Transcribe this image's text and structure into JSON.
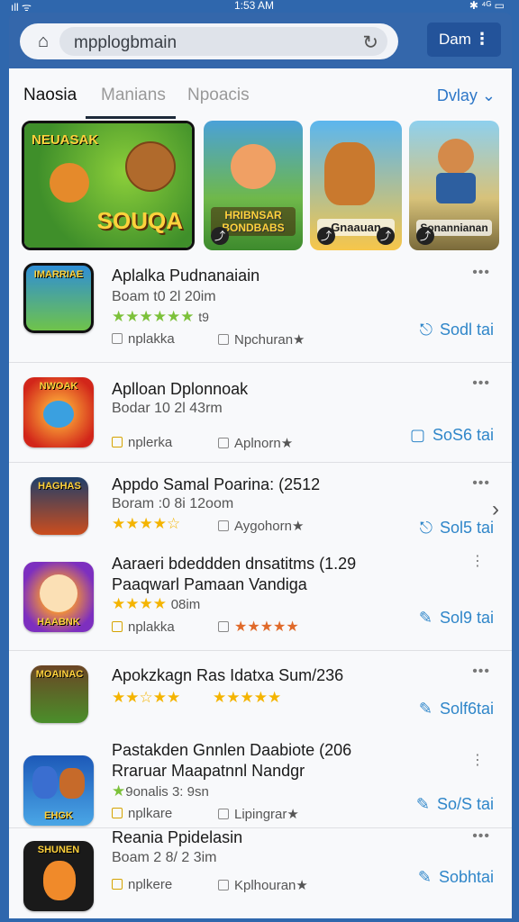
{
  "statusbar": {
    "time": "1:53 AM",
    "left": "ıll ᯤ",
    "right": "✱ ⁴ᴳ ▭"
  },
  "header": {
    "url": "mpplogbmain",
    "menu_label": "Dam"
  },
  "tabs": [
    {
      "label": "Naosia",
      "active": true
    },
    {
      "label": "Manians",
      "active": false
    },
    {
      "label": "Npoacis",
      "active": false
    }
  ],
  "sort_label": "Dvlay ⌄",
  "banners": [
    {
      "title": "SOUQA",
      "top_text": "NEUASAK",
      "colors": [
        "#3f8f2a",
        "#8ccf3a"
      ]
    },
    {
      "title": "HRIBNSAR BONDBABS",
      "colors": [
        "#4aa1d8",
        "#3d8a2d"
      ]
    },
    {
      "title": "Gnaauan",
      "colors": [
        "#5bb6ee",
        "#f7c64a"
      ]
    },
    {
      "title": "Sonannianan",
      "colors": [
        "#8ed0ee",
        "#7a6a3a"
      ]
    }
  ],
  "apps": [
    {
      "name": "Aplalka Pudnanaiain",
      "sub": "Boam t0 2l 20im",
      "stars": "★★★★★★",
      "stars_note": "t9",
      "meta1": "nplakka",
      "meta2": "Npchuran★",
      "action": "Sodl tai",
      "icon_label": "IMARRIAE",
      "icon_colors": [
        "#2f8ed6",
        "#6fc34a"
      ]
    },
    {
      "name": "Aplloan Dplonnoak",
      "sub": "Bodar 10 2l 43rm",
      "meta1": "nplerka",
      "meta2": "Aplnorn★",
      "action": "SoS6 tai",
      "icon_label": "NWOAK",
      "icon_colors": [
        "#ff8a1f",
        "#d2261a"
      ]
    },
    {
      "name": "Appdo Samal Poarina: (2512",
      "sub": "Boram :0 8i 12oom",
      "stars": "★★★★☆",
      "meta2": "Aygohorn★",
      "action": "Sol5 tai",
      "icon_label": "HAGHAS",
      "icon_colors": [
        "#1f3f6a",
        "#cc4d1d"
      ]
    },
    {
      "name": "Aaraeri bdeddden dnsatitms (1.29",
      "name2": "Paaqwarl Pamaan Vandiga",
      "stars": "★★★★",
      "stars_note": "08im",
      "meta1": "nplakka",
      "meta2": "★★★★★",
      "action": "Sol9 tai",
      "icon_label": "HAABNK",
      "icon_colors": [
        "#7d2fbf",
        "#e23ad1"
      ]
    },
    {
      "name": "Apokzkagn Ras Idatxa Sum/236",
      "stars": "★★☆★★",
      "stars2": "★★★★★",
      "action": "Solf6tai",
      "icon_label": "MOAINAC",
      "icon_colors": [
        "#6b4525",
        "#4a8f2a"
      ]
    },
    {
      "name": "Pastakden Gnnlen Daabiote (206",
      "name2": "Rraruar Maapatnnl Nandgr",
      "stars": "★",
      "stars_note": "9onalis 3: 9sn",
      "meta1": "nplkare",
      "meta2": "Lipingrar★",
      "action": "So/S tai",
      "icon_label": "EHGK",
      "icon_colors": [
        "#1d59b8",
        "#4aa6e6"
      ]
    },
    {
      "name": "Reania Ppidelasin",
      "sub": "Boam 2 8/ 2 3im",
      "meta1": "nplkere",
      "meta2": "Kplhouran★",
      "action": "Sobhtai",
      "icon_label": "SHUNEN",
      "icon_colors": [
        "#1a1a1a",
        "#2d2d2d"
      ]
    }
  ]
}
